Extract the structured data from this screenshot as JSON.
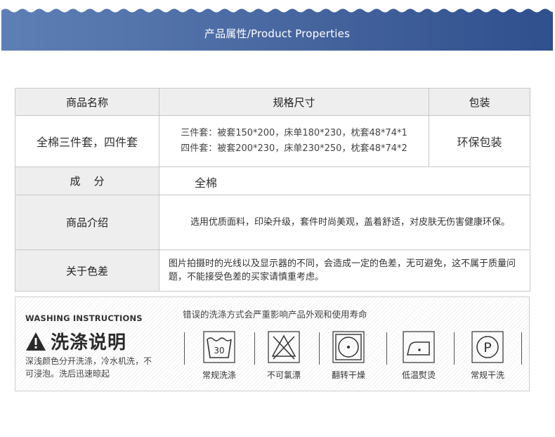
{
  "header": {
    "title": "产品属性/Product Properties"
  },
  "table": {
    "headers": [
      "商品名称",
      "规格尺寸",
      "包装"
    ],
    "product_name": "全棉三件套，四件套",
    "spec_line1": "三件套：被套150*200，床单180*230，枕套48*74*1",
    "spec_line2": "四件套：被套200*230，床单230*250，枕套48*74*2",
    "packaging": "环保包装",
    "composition_label": "成    分",
    "composition_value": "全棉",
    "intro_label": "商品介绍",
    "intro_text": "选用优质面料，印染升级，套件时尚美观，盖着舒适，对皮肤无伤害健康环保。",
    "color_label": "关于色差",
    "color_text": "图片拍摄时的光线以及显示器的不同，会造成一定的色差，无可避免，这不属于质量问题，不能接受色差的买家请慎重考虑。"
  },
  "washing": {
    "title_en": "WASHING INSTRUCTIONS",
    "title_cn": "洗涤说明",
    "desc": "深浅颜色分开洗涤，冷水机洗，不可浸泡。洗后迅速晾起",
    "warning": "错误的洗涤方式会严重影响产品外观和使用寿命",
    "symbols": [
      {
        "icon": "wash-30-icon",
        "label": "常规洗涤",
        "temp": "30"
      },
      {
        "icon": "no-bleach-icon",
        "label": "不可氯漂"
      },
      {
        "icon": "tumble-dry-icon",
        "label": "翻转干燥"
      },
      {
        "icon": "low-iron-icon",
        "label": "低温熨烫"
      },
      {
        "icon": "dry-clean-p-icon",
        "label": "常规干洗",
        "letter": "P"
      }
    ]
  }
}
